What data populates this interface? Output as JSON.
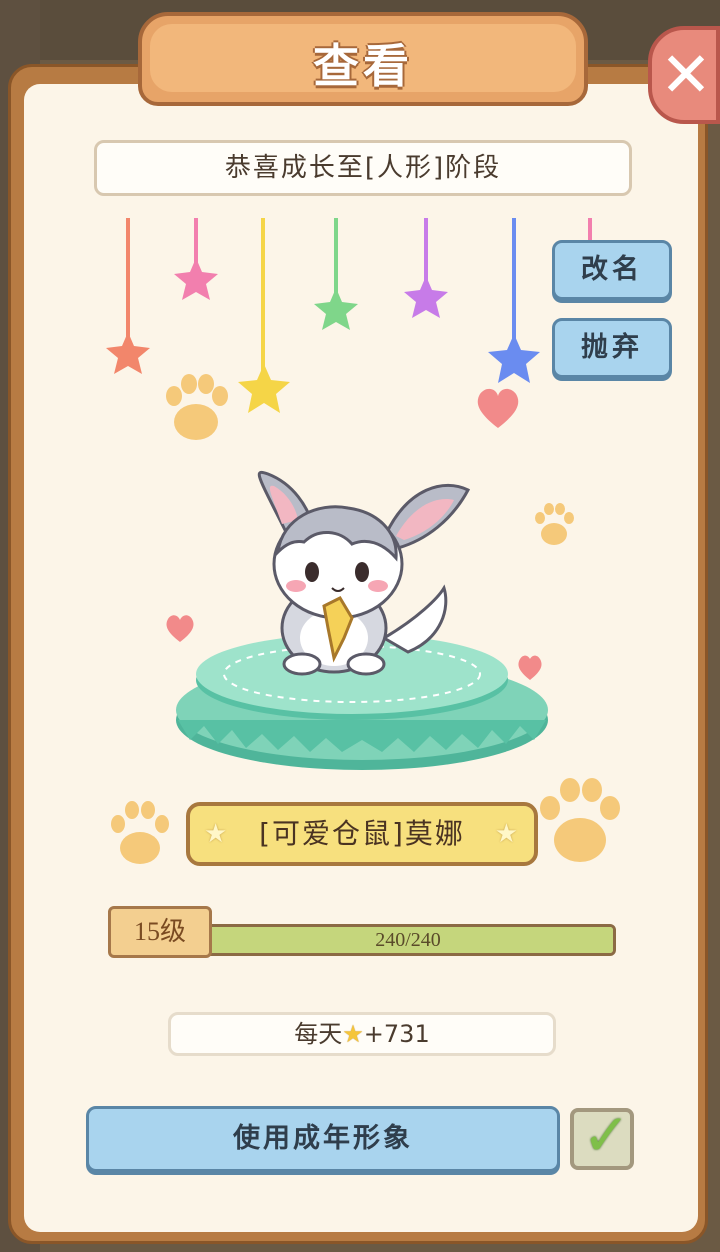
{
  "dialog": {
    "title": "查看",
    "close_label": "✕"
  },
  "banner": {
    "text": "恭喜成长至[人形]阶段"
  },
  "actions": {
    "rename_label": "改名",
    "abandon_label": "抛弃",
    "use_adult_label": "使用成年形象",
    "use_adult_checked": true
  },
  "pet": {
    "name": "[可爱仓鼠]莫娜",
    "level_label": "15级",
    "exp_text": "240/240",
    "exp_fraction": 1.0
  },
  "daily": {
    "prefix": "每天",
    "amount": "+731",
    "icon": "star-icon"
  },
  "colors": {
    "panel_brown": "#b77b43",
    "panel_cream": "#fcf5e8",
    "button_blue": "#a9d4ee",
    "name_yellow": "#f7e07e",
    "exp_green": "#c5d67c",
    "pedestal_teal": "#7fd3b8"
  }
}
